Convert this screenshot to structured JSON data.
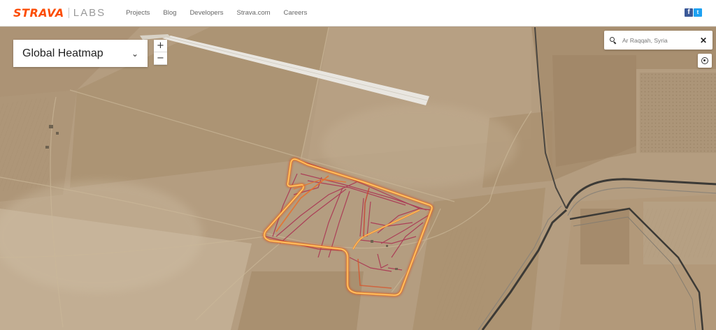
{
  "brand": {
    "name": "STRAVA",
    "sub": "LABS"
  },
  "nav": [
    "Projects",
    "Blog",
    "Developers",
    "Strava.com",
    "Careers"
  ],
  "social": {
    "facebook_icon": "facebook-icon",
    "twitter_icon": "twitter-icon",
    "facebook_glyph": "f",
    "twitter_glyph": "t"
  },
  "map_select": {
    "label": "Global Heatmap",
    "chevron": "⌄"
  },
  "zoom": {
    "in": "+",
    "out": "−"
  },
  "search": {
    "placeholder": "Ar Raqqah, Syria",
    "clear": "✕"
  },
  "colors": {
    "accent": "#fc4c02",
    "heat_core": "#ffd27a",
    "heat_mid": "#f08a2c",
    "heat_outer": "#a8204a",
    "terrain": "#b39c80",
    "road": "#3c3a36"
  }
}
